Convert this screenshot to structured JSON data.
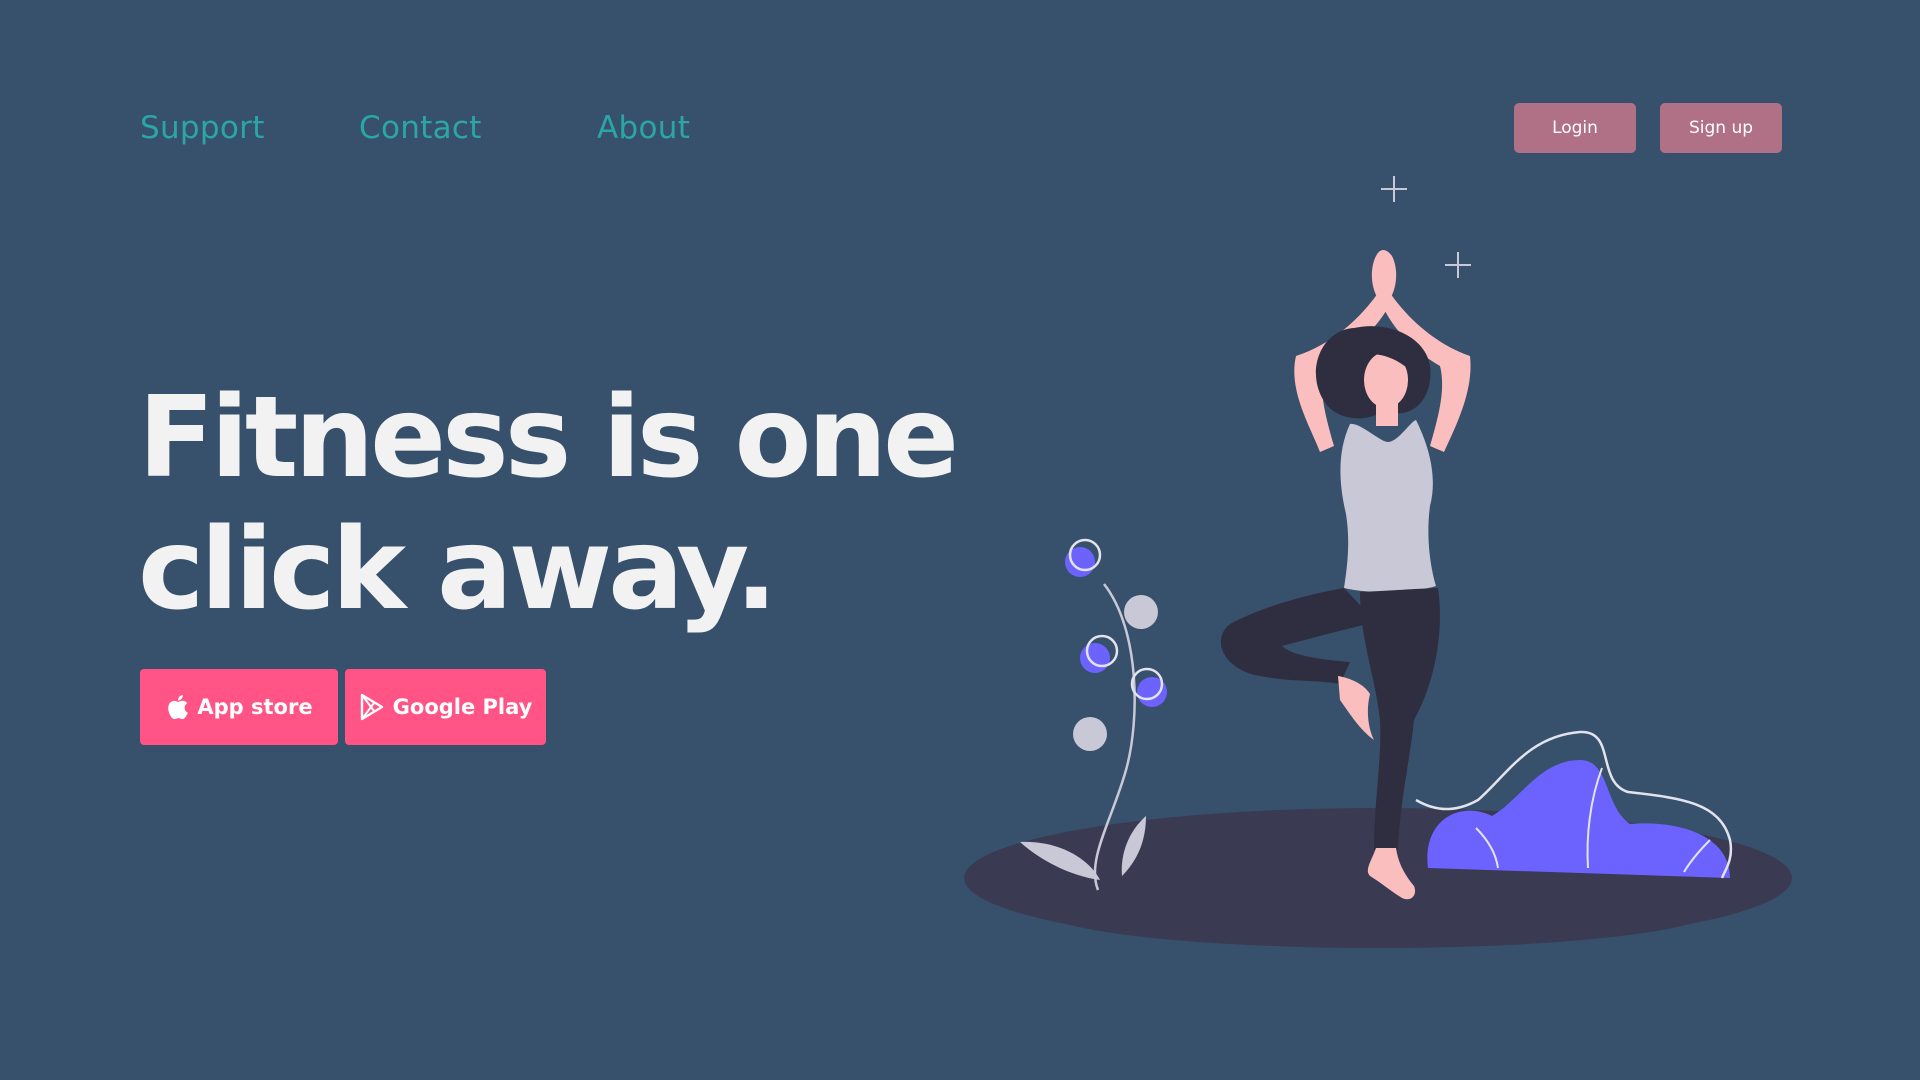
{
  "nav": {
    "links": [
      {
        "label": "Support"
      },
      {
        "label": "Contact"
      },
      {
        "label": "About"
      }
    ]
  },
  "auth": {
    "login_label": "Login",
    "signup_label": "Sign up"
  },
  "hero": {
    "title_line1": "Fitness is one",
    "title_line2": "click away."
  },
  "store_buttons": {
    "appstore_label": "App store",
    "appstore_icon": "apple-icon",
    "googleplay_label": "Google Play",
    "googleplay_icon": "google-play-icon"
  },
  "colors": {
    "background": "#37506b",
    "nav_link": "#2ba6a6",
    "auth_button": "#b07085",
    "store_button": "#ff5485",
    "hero_text": "#f2f2f2",
    "accent_purple": "#6c63ff"
  }
}
